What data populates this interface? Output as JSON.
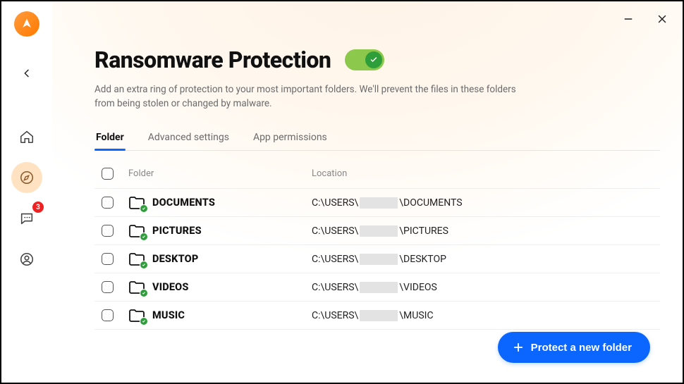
{
  "sidebar": {
    "notifications_badge": "3"
  },
  "page": {
    "title": "Ransomware Protection",
    "description": "Add an extra ring of protection to your most important folders. We'll prevent the files in these folders from being stolen or changed by malware."
  },
  "tabs": [
    {
      "label": "Folder",
      "active": true
    },
    {
      "label": "Advanced settings",
      "active": false
    },
    {
      "label": "App permissions",
      "active": false
    }
  ],
  "table": {
    "headers": {
      "folder": "Folder",
      "location": "Location"
    },
    "rows": [
      {
        "name": "DOCUMENTS",
        "loc_pre": "C:\\USERS\\",
        "loc_post": "\\DOCUMENTS"
      },
      {
        "name": "PICTURES",
        "loc_pre": "C:\\USERS\\",
        "loc_post": "\\PICTURES"
      },
      {
        "name": "DESKTOP",
        "loc_pre": "C:\\USERS\\",
        "loc_post": "\\DESKTOP"
      },
      {
        "name": "VIDEOS",
        "loc_pre": "C:\\USERS\\",
        "loc_post": "\\VIDEOS"
      },
      {
        "name": "MUSIC",
        "loc_pre": "C:\\USERS\\",
        "loc_post": "\\MUSIC"
      }
    ]
  },
  "actions": {
    "protect_new_folder": "Protect a new folder"
  }
}
